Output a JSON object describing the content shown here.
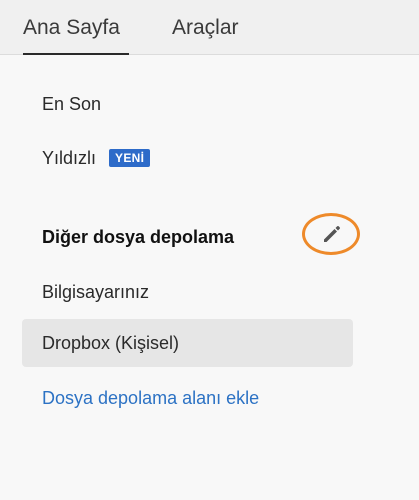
{
  "tabs": [
    {
      "label": "Ana Sayfa",
      "active": true
    },
    {
      "label": "Araçlar",
      "active": false
    }
  ],
  "sidebar": {
    "recent_label": "En Son",
    "starred_label": "Yıldızlı",
    "starred_badge": "YENİ",
    "section_title": "Diğer dosya depolama",
    "edit_icon": "pencil-icon",
    "items": [
      {
        "label": "Bilgisayarınız",
        "selected": false
      },
      {
        "label": "Dropbox (Kişisel)",
        "selected": true
      }
    ],
    "add_storage_label": "Dosya depolama alanı ekle"
  },
  "colors": {
    "badge": "#2d6bc9",
    "link": "#2c72c4",
    "highlight_ring": "#ee8a2a",
    "selected_row": "#e6e6e6"
  }
}
